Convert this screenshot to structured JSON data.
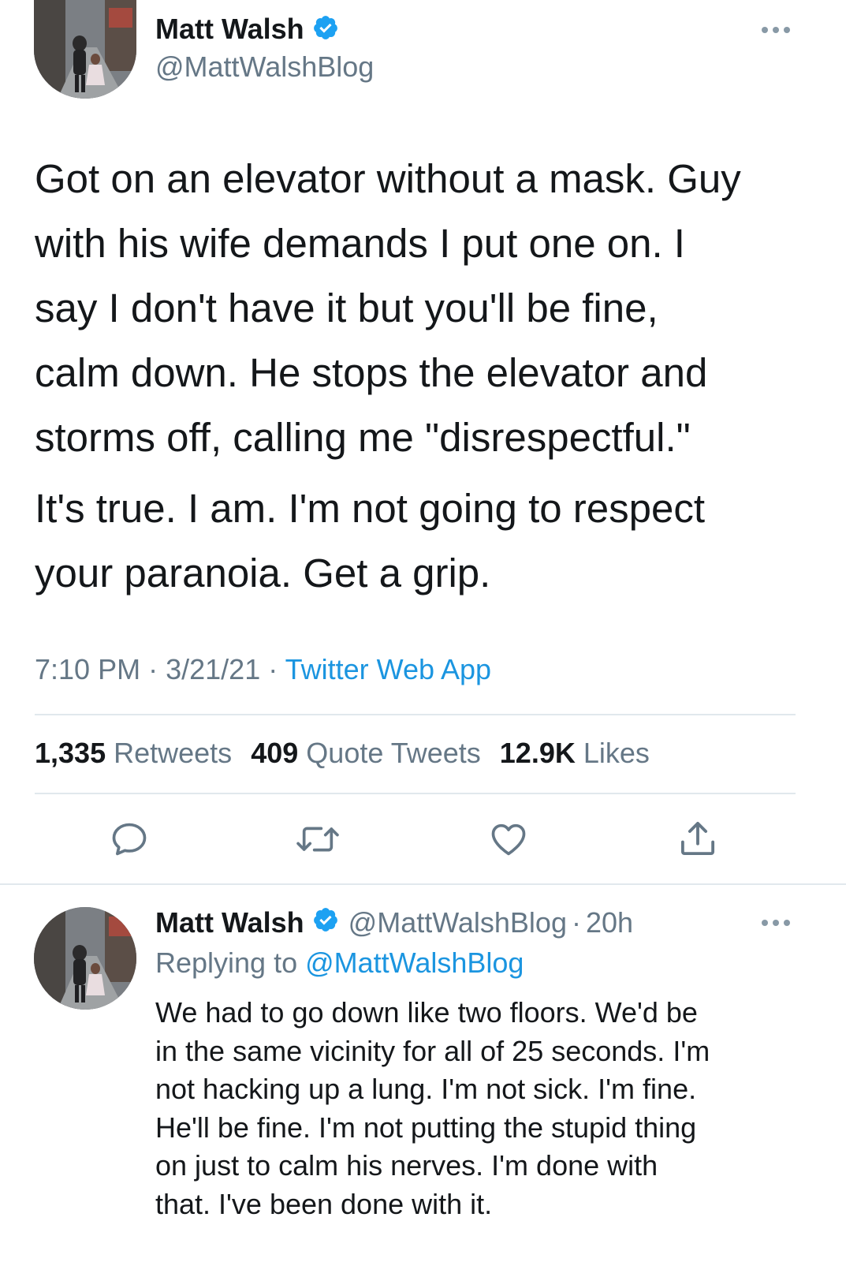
{
  "main_tweet": {
    "author_name": "Matt Walsh",
    "author_handle": "@MattWalshBlog",
    "more_icon": "more-icon",
    "paragraph_1_lines": [
      "Got on an elevator without a mask. Guy",
      "with his wife demands I put one on. I",
      "say I don't have it but you'll be fine,",
      "calm down. He stops the elevator and",
      "storms off, calling me \"disrespectful.\""
    ],
    "paragraph_2_lines": [
      "It's true. I am. I'm not going to respect",
      "your paranoia. Get a grip."
    ],
    "time": "7:10 PM",
    "separator": "·",
    "date": "3/21/21",
    "source": "Twitter Web App",
    "stats": {
      "retweets_count": "1,335",
      "retweets_label": "Retweets",
      "quotes_count": "409",
      "quotes_label": "Quote Tweets",
      "likes_count": "12.9K",
      "likes_label": "Likes"
    },
    "actions": [
      "reply-icon",
      "retweet-icon",
      "like-icon",
      "share-icon"
    ]
  },
  "reply_tweet": {
    "author_name": "Matt Walsh",
    "author_handle": "@MattWalshBlog",
    "separator": "·",
    "age": "20h",
    "replying_prefix": "Replying to",
    "replying_handle": "@MattWalshBlog",
    "text_lines": [
      "We had to go down like two floors. We'd be",
      "in the same vicinity for all of 25 seconds. I'm",
      "not hacking up a lung. I'm not sick. I'm fine.",
      "He'll be fine. I'm not putting the stupid thing",
      "on just to calm his nerves. I'm done with",
      "that. I've been done with it."
    ]
  },
  "colors": {
    "text": "#14171a",
    "secondary": "#657786",
    "accent": "#1b95e0",
    "verified": "#1da1f2",
    "divider": "#e1e8ed"
  }
}
